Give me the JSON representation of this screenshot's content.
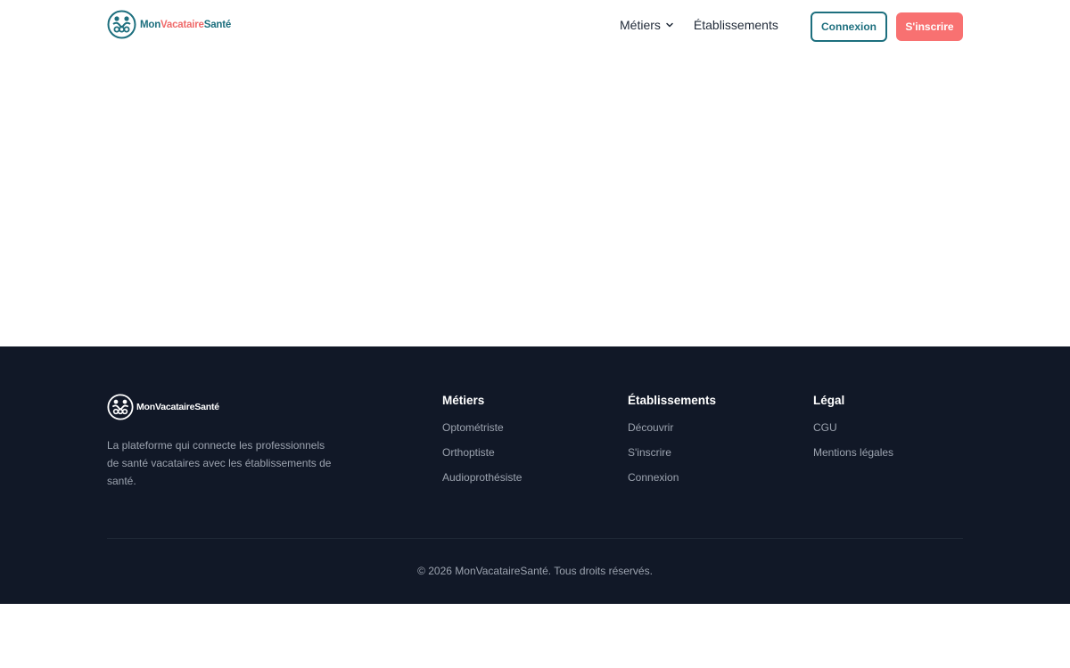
{
  "brand": {
    "part1": "Mon",
    "part2": "Vacataire",
    "part3": "Santé",
    "full": "MonVacataireSanté",
    "colors": {
      "teal": "#1d6f7e",
      "coral": "#f87171",
      "footer_bg": "#111827"
    }
  },
  "header": {
    "nav": [
      {
        "label": "Métiers",
        "icon": "chevron-down-icon"
      },
      {
        "label": "Établissements"
      }
    ],
    "login_label": "Connexion",
    "signup_label": "S'inscrire"
  },
  "footer": {
    "description": "La plateforme qui connecte les professionnels de santé vacataires avec les établissements de santé.",
    "columns": [
      {
        "title": "Métiers",
        "links": [
          "Optométriste",
          "Orthoptiste",
          "Audioprothésiste"
        ]
      },
      {
        "title": "Établissements",
        "links": [
          "Découvrir",
          "S'inscrire",
          "Connexion"
        ]
      },
      {
        "title": "Légal",
        "links": [
          "CGU",
          "Mentions légales"
        ]
      }
    ],
    "copyright": "© 2026 MonVacataireSanté. Tous droits réservés."
  }
}
